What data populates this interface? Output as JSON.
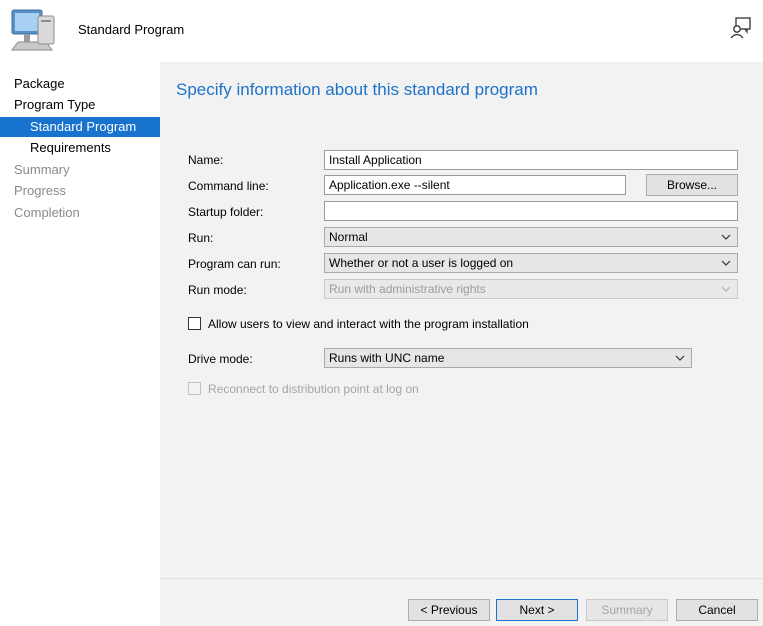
{
  "header": {
    "title": "Standard Program",
    "icon": "computer-icon",
    "feedback_icon": "feedback-icon"
  },
  "nav": {
    "items": [
      {
        "label": "Package"
      },
      {
        "label": "Program Type"
      },
      {
        "label": "Standard Program"
      },
      {
        "label": "Requirements"
      },
      {
        "label": "Summary"
      },
      {
        "label": "Progress"
      },
      {
        "label": "Completion"
      }
    ]
  },
  "main": {
    "title": "Specify information about this standard program",
    "name_label": "Name:",
    "name_value": "Install Application",
    "command_label": "Command line:",
    "command_value": "Application.exe --silent",
    "browse_label": "Browse...",
    "startup_label": "Startup folder:",
    "startup_value": "",
    "run_label": "Run:",
    "run_value": "Normal",
    "canrun_label": "Program can run:",
    "canrun_value": "Whether or not a user is logged on",
    "runmode_label": "Run mode:",
    "runmode_value": "Run with administrative rights",
    "allow_label": "Allow users to view and interact with the program installation",
    "drive_label": "Drive mode:",
    "drive_value": "Runs with UNC name",
    "reconnect_label": "Reconnect to distribution point at log on"
  },
  "footer": {
    "previous": "< Previous",
    "next": "Next >",
    "summary": "Summary",
    "cancel": "Cancel"
  },
  "colors": {
    "accent": "#1873cf",
    "title_blue": "#1e72c8",
    "pane_bg": "#f2f2f2"
  }
}
